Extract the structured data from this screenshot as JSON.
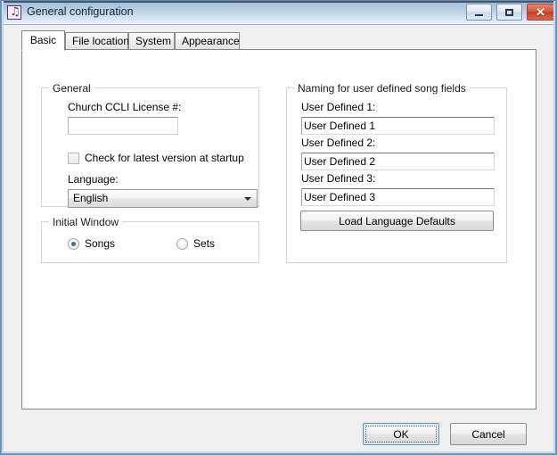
{
  "window": {
    "title": "General configuration",
    "icon": "music-note-icon",
    "controls": {
      "minimize": "Minimize",
      "maximize": "Maximize",
      "close": "Close",
      "close_glyph": "✕"
    },
    "accent_blue": "#bcd9ee",
    "close_red": "#c43c24"
  },
  "tabs": [
    {
      "id": "basic",
      "label": "Basic",
      "active": true
    },
    {
      "id": "file-locations",
      "label": "File locations",
      "active": false
    },
    {
      "id": "system",
      "label": "System",
      "active": false
    },
    {
      "id": "appearance",
      "label": "Appearance",
      "active": false
    }
  ],
  "general_group": {
    "title": "General",
    "ccli": {
      "label": "Church CCLI License #:",
      "value": "",
      "placeholder": ""
    },
    "check_latest": {
      "label": "Check for latest version at startup",
      "checked": false
    },
    "language": {
      "label": "Language:",
      "selected": "English",
      "options": [
        "English"
      ]
    }
  },
  "initial_window_group": {
    "title": "Initial Window",
    "options": [
      {
        "label": "Songs",
        "selected": true
      },
      {
        "label": "Sets",
        "selected": false
      }
    ]
  },
  "naming_group": {
    "title": "Naming for user defined song fields",
    "fields": [
      {
        "label": "User Defined 1:",
        "value": "User Defined 1"
      },
      {
        "label": "User Defined 2:",
        "value": "User Defined 2"
      },
      {
        "label": "User Defined 3:",
        "value": "User Defined 3"
      }
    ],
    "load_defaults_button": "Load Language Defaults"
  },
  "footer": {
    "ok": "OK",
    "cancel": "Cancel"
  }
}
